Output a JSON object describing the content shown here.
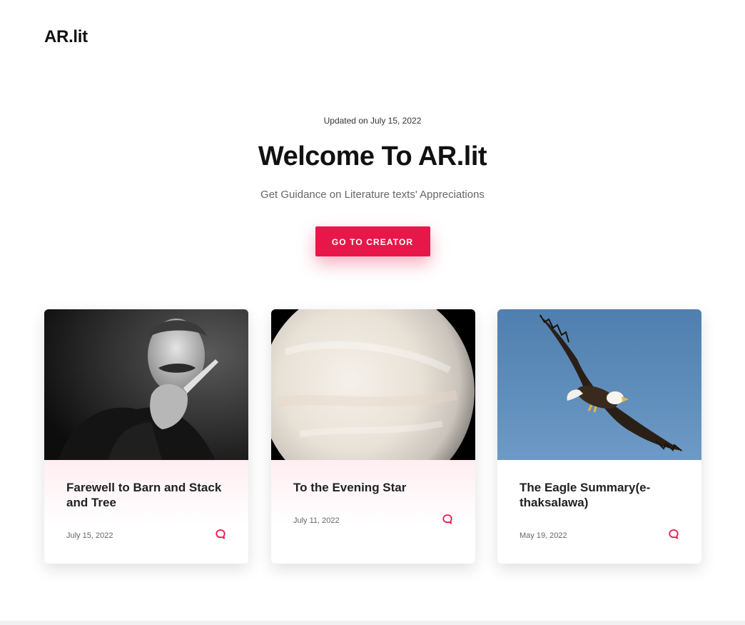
{
  "header": {
    "brand": "AR.lit"
  },
  "hero": {
    "updated": "Updated on July 15, 2022",
    "title": "Welcome To AR.lit",
    "subtitle": "Get Guidance on Literature texts' Appreciations",
    "cta_label": "GO TO CREATOR"
  },
  "colors": {
    "accent": "#e8174a",
    "text": "#111111",
    "muted": "#666666"
  },
  "cards": [
    {
      "title": "Farewell to Barn and Stack and Tree",
      "date": "July 15, 2022",
      "icon": "comment-icon"
    },
    {
      "title": "To the Evening Star",
      "date": "July 11, 2022",
      "icon": "comment-icon"
    },
    {
      "title": "The Eagle Summary(e-thaksalawa)",
      "date": "May 19, 2022",
      "icon": "comment-icon"
    }
  ]
}
